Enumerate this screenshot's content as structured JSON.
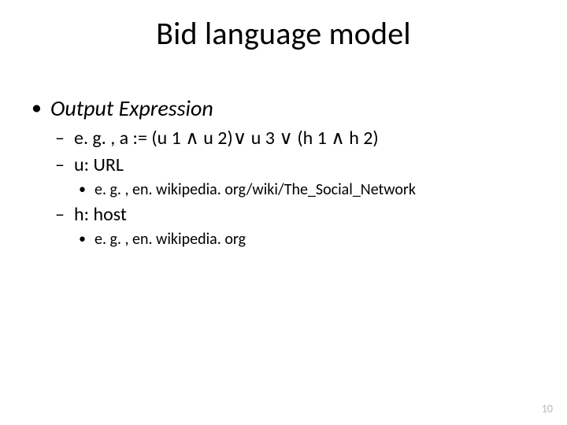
{
  "title": "Bid language model",
  "bullets": {
    "l1": {
      "output_expression": "Output Expression"
    },
    "l2": {
      "example_expr": "e. g. , a := (u 1 ∧ u 2)∨ u 3 ∨ (h 1 ∧ h 2)",
      "u_url": "u: URL",
      "h_host": "h: host"
    },
    "l3": {
      "u_example": "e. g. , en. wikipedia. org/wiki/The_Social_Network",
      "h_example": "e. g. , en. wikipedia. org"
    }
  },
  "page_number": "10"
}
